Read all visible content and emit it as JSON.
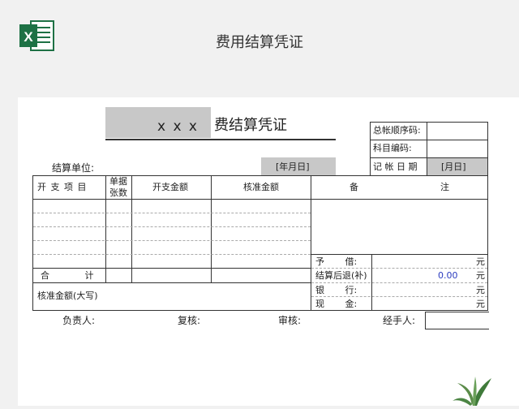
{
  "app": {
    "title": "费用结算凭证",
    "logo_letter": "X",
    "logo_color": "#1e7145"
  },
  "voucher": {
    "name_placeholder": "x x x",
    "title": "费结算凭证",
    "right_labels": {
      "seq": "总帐顺序码:",
      "subject": "科目编码:",
      "date": "记 帐 日 期",
      "month_day": "[月日]"
    },
    "unit_label": "结算单位:",
    "year_month_day": "[年月日]",
    "headers": {
      "item": "开 支 项 目",
      "doc_count_1": "单据",
      "doc_count_2": "张数",
      "amount": "开支金额",
      "approved": "核准金额",
      "remark": "备",
      "note": "注"
    },
    "total_label": "合 计",
    "approved_upper": "核准金额(大写)",
    "summary": [
      {
        "label": "予 借:",
        "value": "",
        "unit": "元"
      },
      {
        "label": "结算后退(补)",
        "value": "0.00",
        "unit": "元"
      },
      {
        "label": "银 行:",
        "value": "",
        "unit": "元"
      },
      {
        "label": "现 金:",
        "value": "",
        "unit": "元"
      }
    ],
    "signatures": {
      "responsible": "负责人:",
      "review": "复核:",
      "audit": "审核:",
      "handler": "经手人:"
    }
  },
  "colors": {
    "accent_value": "#2a3bbf",
    "grey_cell": "#c8c8c8"
  }
}
